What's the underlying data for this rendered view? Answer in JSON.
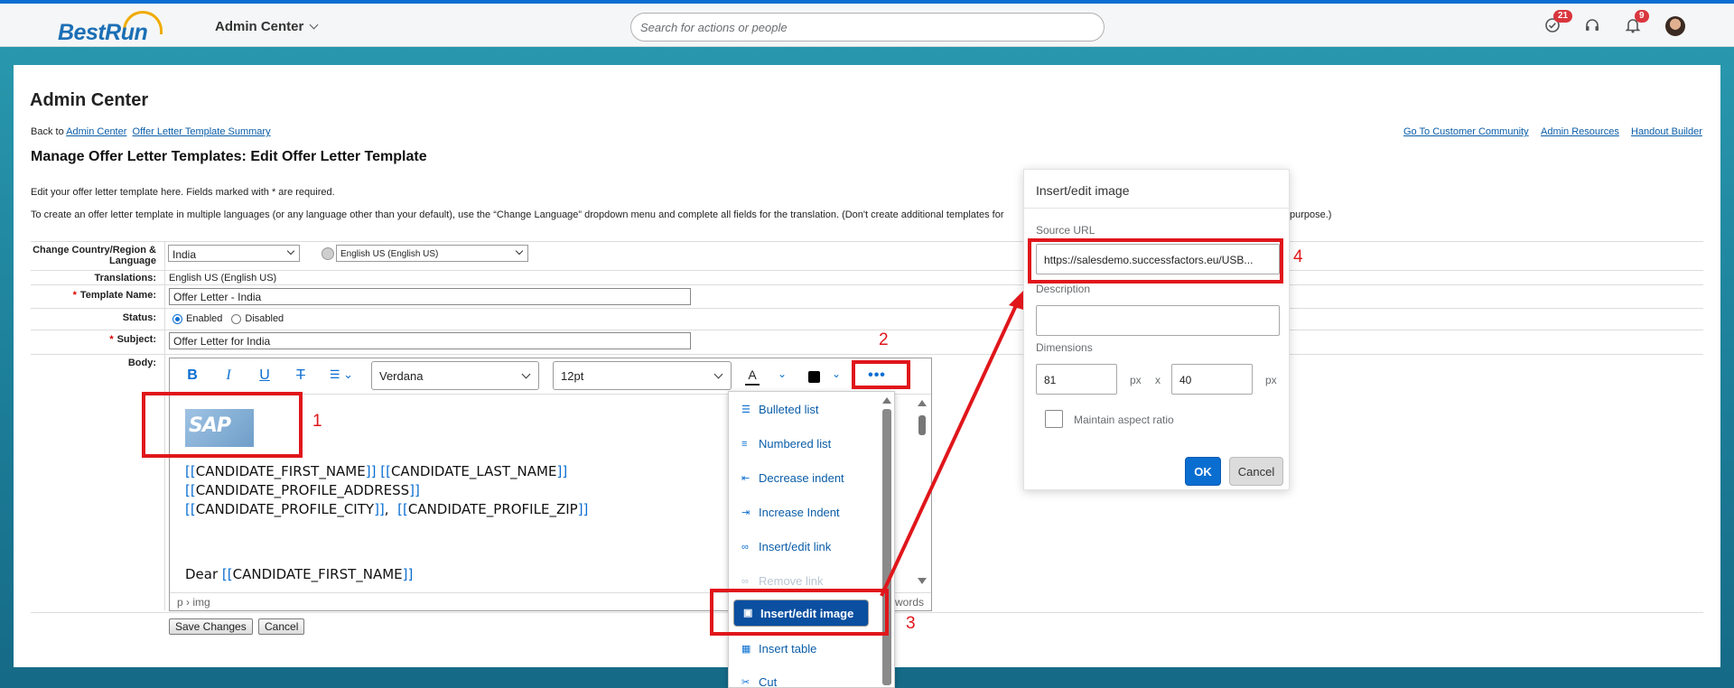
{
  "shell": {
    "logo_main": "BestRun",
    "app_name": "Admin Center",
    "search_placeholder": "Search for actions or people",
    "todo_badge": "21",
    "notif_badge": "9"
  },
  "page": {
    "title": "Admin Center",
    "back_prefix": "Back to",
    "back_link1": "Admin Center",
    "back_link2": "Offer Letter Template Summary",
    "right_links": [
      "Go To Customer Community",
      "Admin Resources",
      "Handout Builder"
    ],
    "heading": "Manage Offer Letter Templates: Edit Offer Letter Template",
    "intro": "Edit your offer letter template here. Fields marked with * are required.",
    "intro2": "To create an offer letter template in multiple languages (or any language other than your default), use the “Change Language” dropdown menu and complete all fields for the translation. (Don't create additional templates for",
    "intro2_end": "purpose.)"
  },
  "form": {
    "country_label": "Change Country/Region & Language",
    "country_value": "India",
    "language_value": "English US (English US)",
    "translations_label": "Translations:",
    "translations_value": "English US (English US)",
    "template_name_label": "Template Name:",
    "template_name_value": "Offer Letter - India",
    "status_label": "Status:",
    "status_enabled": "Enabled",
    "status_disabled": "Disabled",
    "subject_label": "Subject:",
    "subject_value": "Offer Letter for India",
    "body_label": "Body:",
    "save_label": "Save Changes",
    "cancel_label": "Cancel"
  },
  "editor": {
    "font": "Verdana",
    "size": "12pt",
    "logo_text": "SAP",
    "line1a": "CANDIDATE_FIRST_NAME",
    "line1b": "CANDIDATE_LAST_NAME",
    "line2": "CANDIDATE_PROFILE_ADDRESS",
    "line3a": "CANDIDATE_PROFILE_CITY",
    "line3b": "CANDIDATE_PROFILE_ZIP",
    "dear": "Dear",
    "dear_field": "CANDIDATE_FIRST_NAME",
    "path": "p › img",
    "words": "words",
    "open": "[[",
    "close": "]]",
    "comma": ","
  },
  "menu": {
    "items": [
      "Bulleted list",
      "Numbered list",
      "Decrease indent",
      "Increase Indent",
      "Insert/edit link",
      "Remove link",
      "Insert/edit image",
      "Insert table",
      "Cut"
    ],
    "icons": [
      "bulleted-list-icon",
      "numbered-list-icon",
      "decrease-indent-icon",
      "increase-indent-icon",
      "link-icon",
      "unlink-icon",
      "image-icon",
      "table-icon",
      "scissors-icon"
    ]
  },
  "dialog": {
    "title": "Insert/edit image",
    "source_label": "Source URL",
    "source_value": "https://salesdemo.successfactors.eu/USB...",
    "description_label": "Description",
    "description_value": "",
    "dimensions_label": "Dimensions",
    "width": "81",
    "height": "40",
    "px": "px",
    "x": "x",
    "aspect_label": "Maintain aspect ratio",
    "ok": "OK",
    "cancel": "Cancel"
  },
  "annotations": {
    "n1": "1",
    "n2": "2",
    "n3": "3",
    "n4": "4",
    "color": "#e0161b"
  }
}
